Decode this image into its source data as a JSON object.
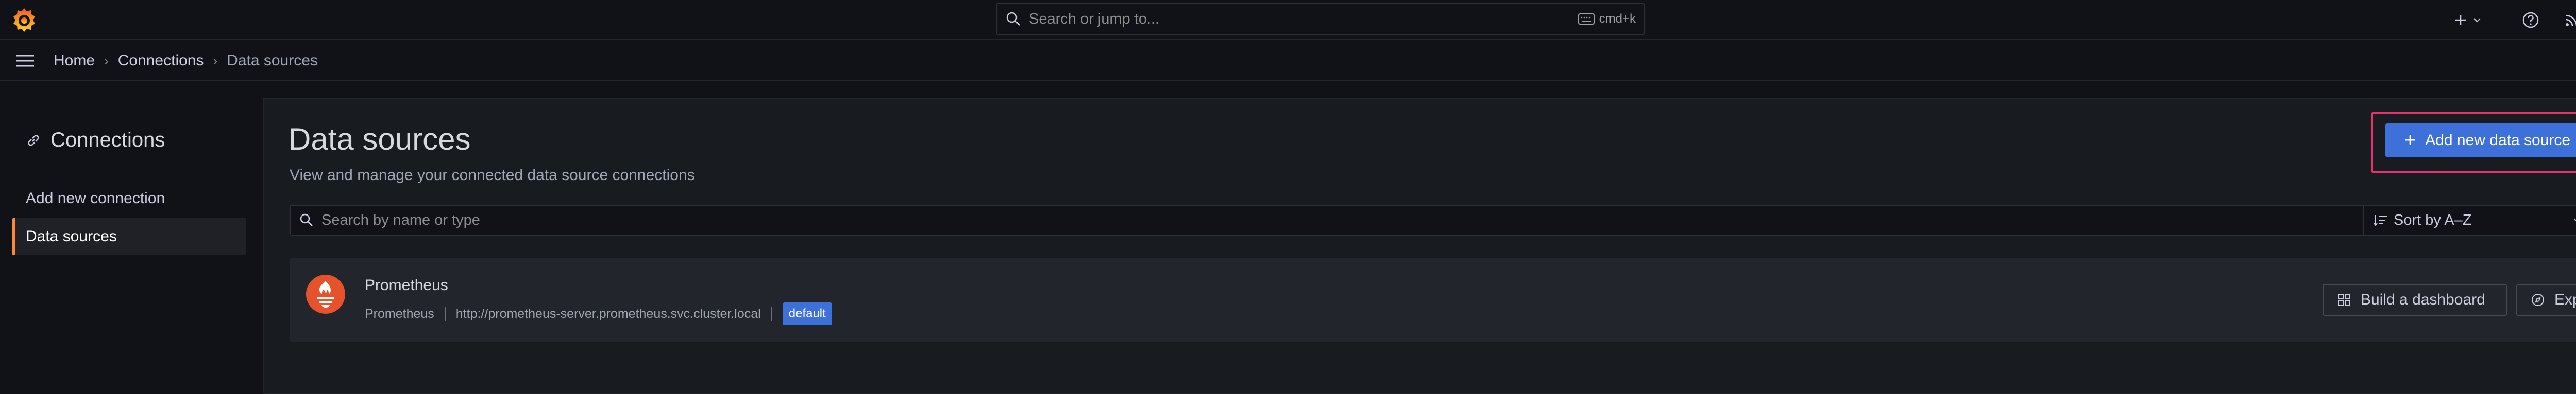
{
  "topbar": {
    "search_placeholder": "Search or jump to...",
    "search_shortcut": "cmd+k"
  },
  "breadcrumbs": {
    "items": [
      "Home",
      "Connections",
      "Data sources"
    ],
    "separator": "›"
  },
  "sidebar": {
    "title": "Connections",
    "items": [
      {
        "label": "Add new connection",
        "active": false
      },
      {
        "label": "Data sources",
        "active": true
      }
    ]
  },
  "main": {
    "title": "Data sources",
    "description": "View and manage your connected data source connections",
    "add_button_label": "Add new data source",
    "filter_placeholder": "Search by name or type",
    "sort_label": "Sort by A–Z",
    "datasources": [
      {
        "name": "Prometheus",
        "type": "Prometheus",
        "url": "http://prometheus-server.prometheus.svc.cluster.local",
        "badge": "default",
        "build_label": "Build a dashboard",
        "explore_label": "Explore"
      }
    ]
  },
  "colors": {
    "background": "#111217",
    "panel": "#181b1f",
    "card": "#22252b",
    "primary": "#3d71d9",
    "accent": "#ff8833",
    "highlight": "#e8336a",
    "prometheus": "#e6522c"
  }
}
